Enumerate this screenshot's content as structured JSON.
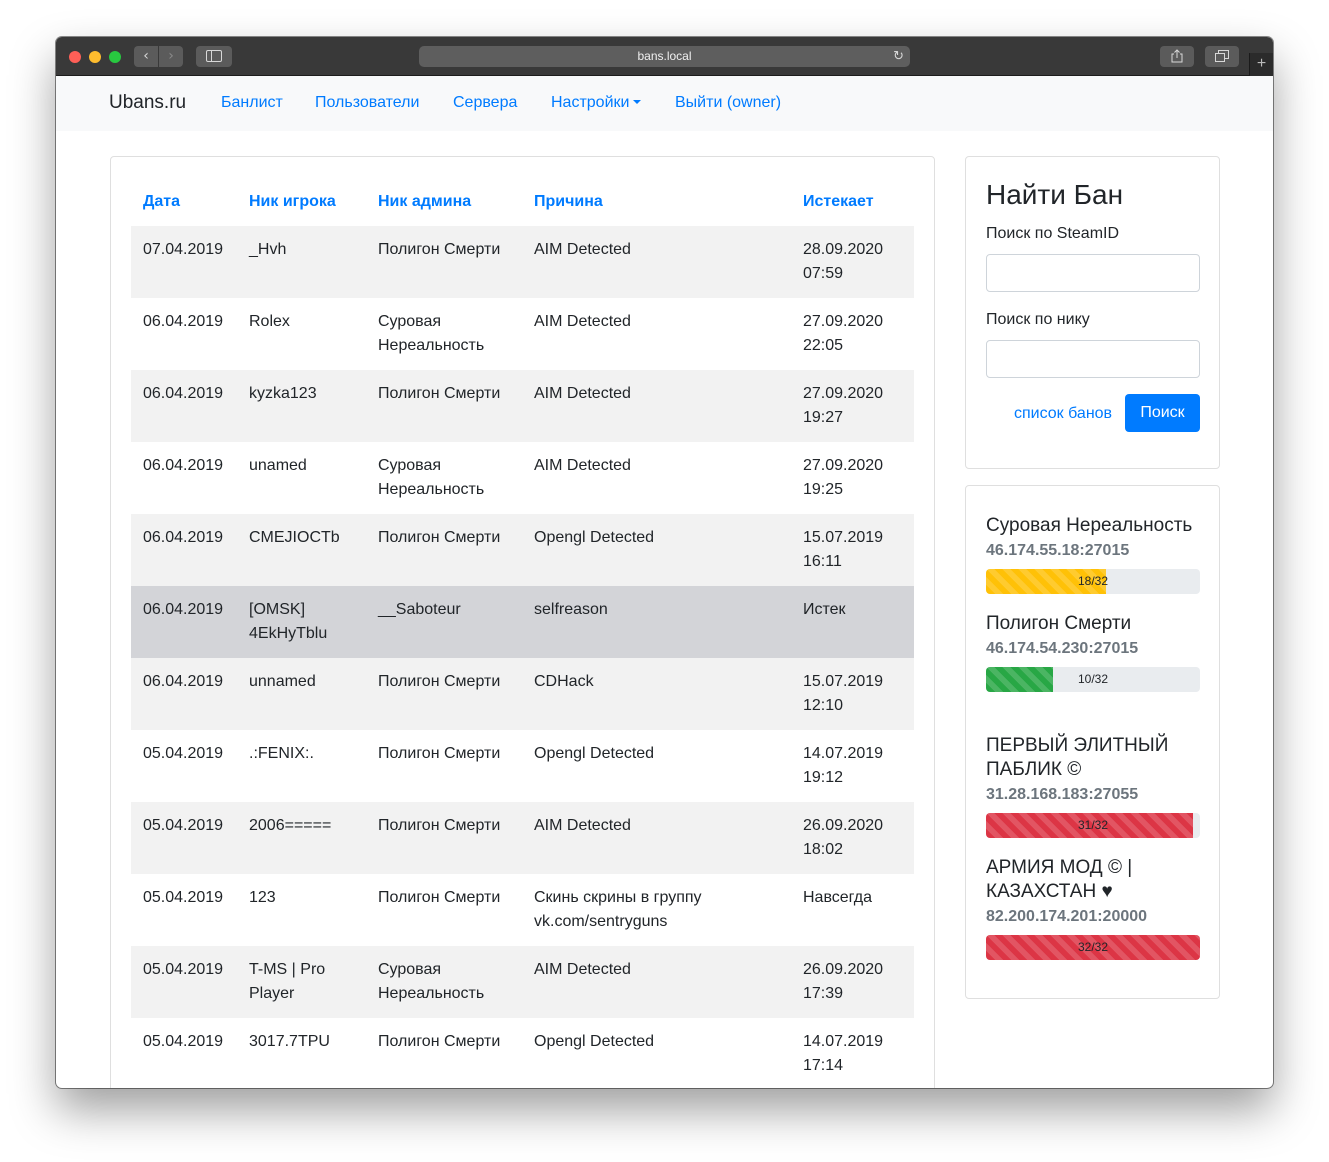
{
  "browser": {
    "url": "bans.local"
  },
  "navbar": {
    "brand": "Ubans.ru",
    "links": [
      "Банлист",
      "Пользователи",
      "Сервера",
      "Настройки",
      "Выйти (owner)"
    ]
  },
  "table": {
    "headers": [
      "Дата",
      "Ник игрока",
      "Ник админа",
      "Причина",
      "Истекает"
    ],
    "rows": [
      {
        "date": "07.04.2019",
        "player": "_Hvh",
        "admin": "Полигон Смерти",
        "reason": "AIM Detected",
        "expires": "28.09.2020 07:59"
      },
      {
        "date": "06.04.2019",
        "player": "Rolex",
        "admin": "Суровая Нереальность",
        "reason": "AIM Detected",
        "expires": "27.09.2020 22:05"
      },
      {
        "date": "06.04.2019",
        "player": "kyzka123",
        "admin": "Полигон Смерти",
        "reason": "AIM Detected",
        "expires": "27.09.2020 19:27"
      },
      {
        "date": "06.04.2019",
        "player": "unamed",
        "admin": "Суровая Нереальность",
        "reason": "AIM Detected",
        "expires": "27.09.2020 19:25"
      },
      {
        "date": "06.04.2019",
        "player": "CMEJIOCTb",
        "admin": "Полигон Смерти",
        "reason": "Opengl Detected",
        "expires": "15.07.2019 16:11"
      },
      {
        "date": "06.04.2019",
        "player": "[OMSK] 4EkHyTblu",
        "admin": "__Saboteur",
        "reason": "selfreason",
        "expires": "Истек",
        "expired": true
      },
      {
        "date": "06.04.2019",
        "player": "unnamed",
        "admin": "Полигон Смерти",
        "reason": "CDHack",
        "expires": "15.07.2019 12:10"
      },
      {
        "date": "05.04.2019",
        "player": ".:FENIX:.",
        "admin": "Полигон Смерти",
        "reason": "Opengl Detected",
        "expires": "14.07.2019 19:12"
      },
      {
        "date": "05.04.2019",
        "player": "2006=====",
        "admin": "Полигон Смерти",
        "reason": "AIM Detected",
        "expires": "26.09.2020 18:02"
      },
      {
        "date": "05.04.2019",
        "player": "123",
        "admin": "Полигон Смерти",
        "reason": "Скинь скрины в группу vk.com/sentryguns",
        "expires": "Навсегда"
      },
      {
        "date": "05.04.2019",
        "player": "T-MS | Pro Player",
        "admin": "Суровая Нереальность",
        "reason": "AIM Detected",
        "expires": "26.09.2020 17:39"
      },
      {
        "date": "05.04.2019",
        "player": "3017.7TPU",
        "admin": "Полигон Смерти",
        "reason": "Opengl Detected",
        "expires": "14.07.2019 17:14"
      }
    ]
  },
  "search": {
    "title": "Найти Бан",
    "steamid_label": "Поиск по SteamID",
    "steamid_value": "",
    "nick_label": "Поиск по нику",
    "nick_value": "",
    "list_link": "список банов",
    "submit_label": "Поиск",
    "accent_color": "#007bff"
  },
  "servers": [
    {
      "name": "Суровая Нереальность",
      "address": "46.174.55.18:27015",
      "players": "18/32",
      "fill": 0.5625,
      "color": "#ffc107"
    },
    {
      "name": "Полигон Смерти",
      "address": "46.174.54.230:27015",
      "players": "10/32",
      "fill": 0.3125,
      "color": "#28a745"
    },
    {
      "name": "ПЕРВЫЙ ЭЛИТНЫЙ ПАБЛИК ©",
      "address": "31.28.168.183:27055",
      "players": "31/32",
      "fill": 0.96875,
      "color": "#dc3545"
    },
    {
      "name": "АРМИЯ МОД © | КАЗАХСТАН ♥",
      "address": "82.200.174.201:20000",
      "players": "32/32",
      "fill": 1.0,
      "color": "#dc3545"
    }
  ]
}
